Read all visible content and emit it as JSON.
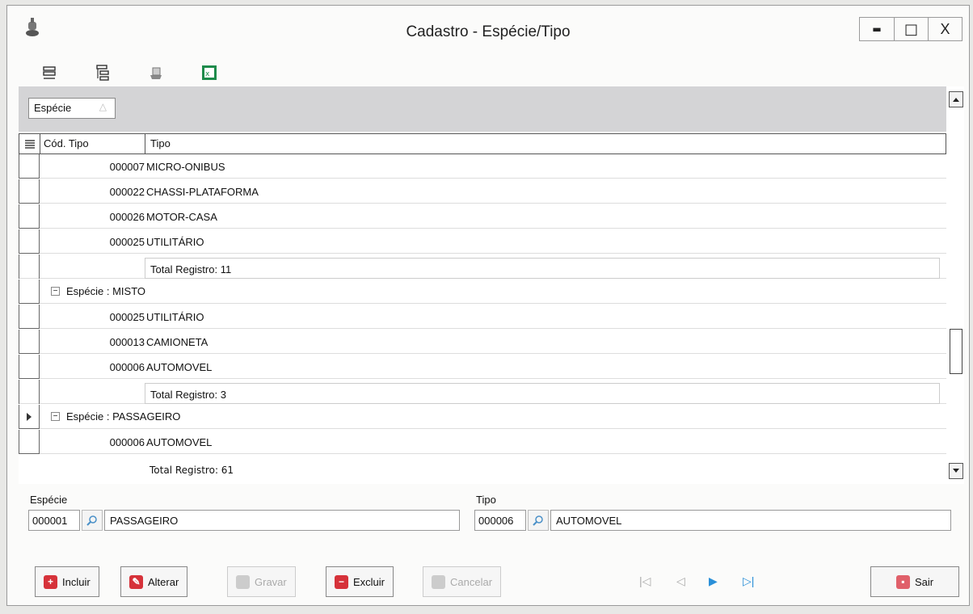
{
  "window": {
    "title": "Cadastro - Espécie/Tipo",
    "minimize_glyph": "▬",
    "maximize_glyph": "□",
    "close_glyph": "X"
  },
  "group_panel": {
    "chip_label": "Espécie",
    "chip_sort_glyph": "△"
  },
  "grid": {
    "columns": [
      "Cód. Tipo",
      "Tipo"
    ],
    "rows": [
      {
        "kind": "data",
        "code": "000007",
        "tipo": "MICRO-ONIBUS"
      },
      {
        "kind": "data",
        "code": "000022",
        "tipo": "CHASSI-PLATAFORMA"
      },
      {
        "kind": "data",
        "code": "000026",
        "tipo": "MOTOR-CASA"
      },
      {
        "kind": "data",
        "code": "000025",
        "tipo": "UTILITÁRIO"
      },
      {
        "kind": "total",
        "text": "Total Registro: 11"
      },
      {
        "kind": "group",
        "text": "Espécie : MISTO"
      },
      {
        "kind": "data",
        "code": "000025",
        "tipo": "UTILITÁRIO"
      },
      {
        "kind": "data",
        "code": "000013",
        "tipo": "CAMIONETA"
      },
      {
        "kind": "data",
        "code": "000006",
        "tipo": "AUTOMOVEL"
      },
      {
        "kind": "total",
        "text": "Total Registro: 3"
      },
      {
        "kind": "group",
        "text": "Espécie : PASSAGEIRO",
        "current": true
      },
      {
        "kind": "data",
        "code": "000006",
        "tipo": "AUTOMOVEL"
      }
    ],
    "footer_total": "Total Registro: 61"
  },
  "form": {
    "especie_label": "Espécie",
    "especie_code": "000001",
    "especie_name": "PASSAGEIRO",
    "tipo_label": "Tipo",
    "tipo_code": "000006",
    "tipo_name": "AUTOMOVEL"
  },
  "buttons": {
    "incluir": "Incluir",
    "alterar": "Alterar",
    "gravar": "Gravar",
    "excluir": "Excluir",
    "cancelar": "Cancelar",
    "sair": "Sair"
  },
  "nav": {
    "first": "|◁",
    "prev": "◁",
    "next": "▶",
    "last": "▷|"
  },
  "colors": {
    "accent_red": "#d6323a",
    "nav_blue": "#2a8fd8",
    "group_bar": "#d4d4d6"
  }
}
